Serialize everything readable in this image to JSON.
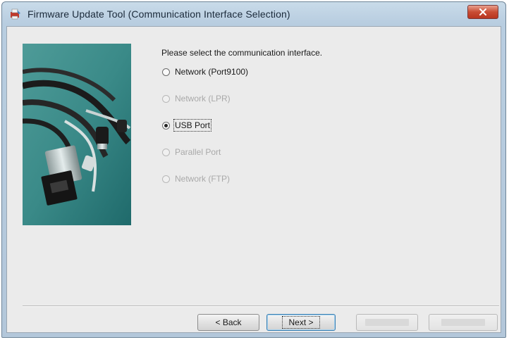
{
  "window": {
    "title": "Firmware Update Tool (Communication Interface Selection)",
    "app_icon": "printer-app-icon",
    "close_icon": "close-icon"
  },
  "prompt": "Please select the communication interface.",
  "interfaces": [
    {
      "label": "Network (Port9100)",
      "selected": false,
      "enabled": true
    },
    {
      "label": "Network (LPR)",
      "selected": false,
      "enabled": false
    },
    {
      "label": "USB Port",
      "selected": true,
      "enabled": true
    },
    {
      "label": "Parallel Port",
      "selected": false,
      "enabled": false
    },
    {
      "label": "Network (FTP)",
      "selected": false,
      "enabled": false
    }
  ],
  "buttons": {
    "back": "< Back",
    "next": "Next >"
  },
  "colors": {
    "titlebar": "#b8cde0",
    "client_bg": "#ebebeb",
    "close_button": "#c94c33",
    "image_teal": "#3a8a88"
  }
}
